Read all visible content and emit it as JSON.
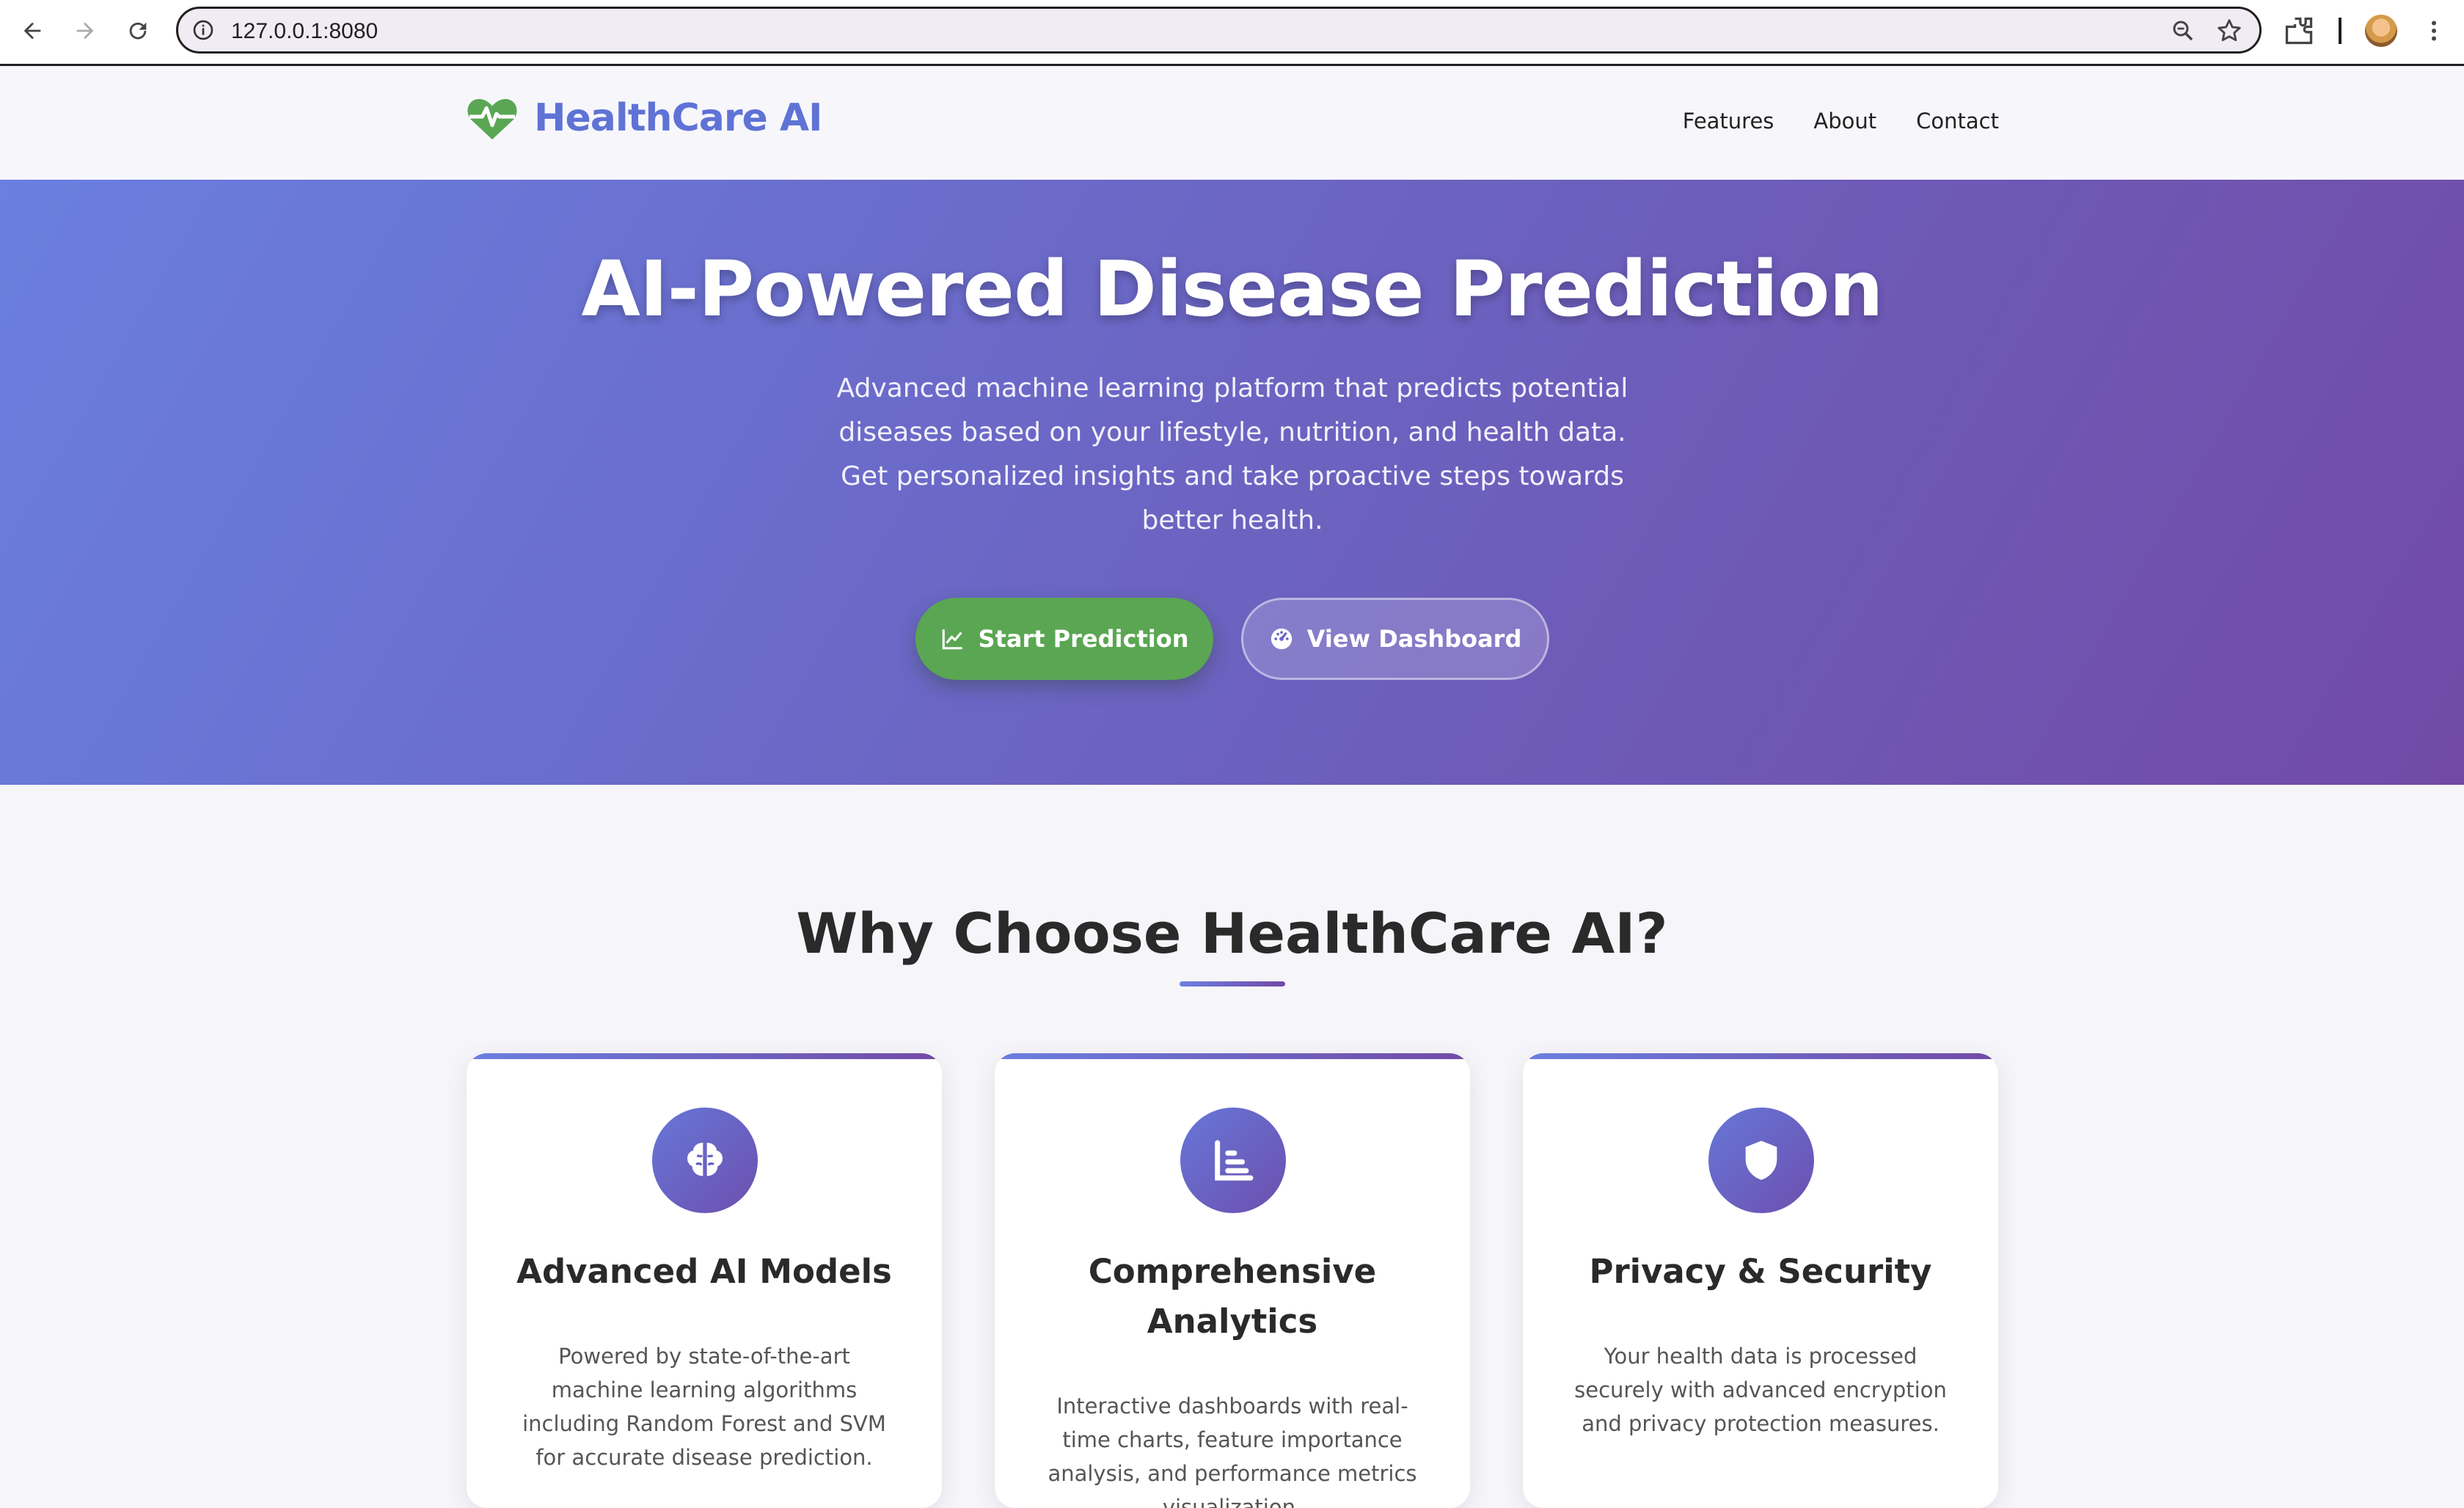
{
  "browser": {
    "url": "127.0.0.1:8080"
  },
  "header": {
    "brand": "HealthCare AI",
    "brand_color": "#5f73d6",
    "nav": [
      "Features",
      "About",
      "Contact"
    ]
  },
  "hero": {
    "title": "AI-Powered Disease Prediction",
    "subtitle": "Advanced machine learning platform that predicts potential diseases based on your lifestyle, nutrition, and health data. Get personalized insights and take proactive steps towards better health.",
    "primary_button": "Start Prediction",
    "secondary_button": "View Dashboard",
    "gradient": [
      "#6a7fe0",
      "#724aa6"
    ],
    "primary_color": "#5aa653"
  },
  "features": {
    "title": "Why Choose HealthCare AI?",
    "cards": [
      {
        "icon": "brain-icon",
        "title": "Advanced AI Models",
        "description": "Powered by state-of-the-art machine learning algorithms including Random Forest and SVM for accurate disease prediction."
      },
      {
        "icon": "chart-bar-icon",
        "title": "Comprehensive Analytics",
        "description": "Interactive dashboards with real-time charts, feature importance analysis, and performance metrics visualization."
      },
      {
        "icon": "shield-icon",
        "title": "Privacy & Security",
        "description": "Your health data is processed securely with advanced encryption and privacy protection measures."
      }
    ]
  }
}
